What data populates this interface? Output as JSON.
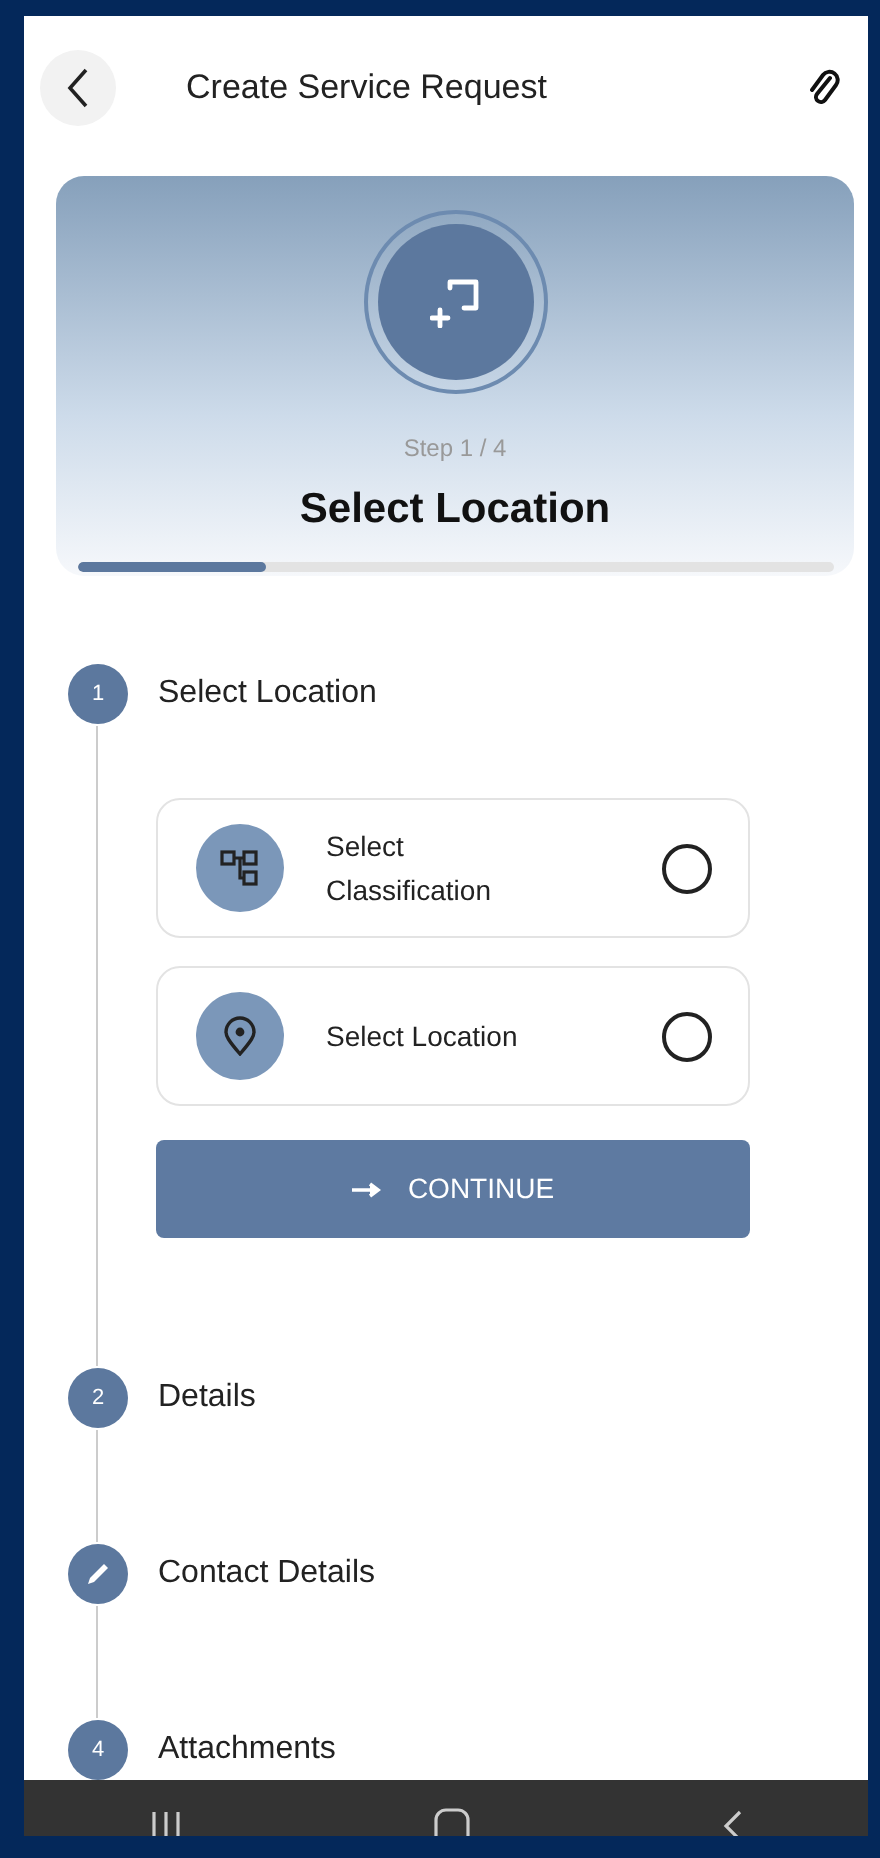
{
  "header": {
    "title": "Create Service Request"
  },
  "hero": {
    "step_text": "Step 1 / 4",
    "title": "Select Location",
    "progress": {
      "level": 0.25
    }
  },
  "steps": [
    {
      "kind": "number",
      "number": "1",
      "label": "Select Location",
      "options": [
        {
          "kind": "tree",
          "label": "Select Classification",
          "selected": false
        },
        {
          "kind": "pin",
          "label": "Select Location",
          "selected": false
        }
      ],
      "button": "CONTINUE"
    },
    {
      "kind": "number",
      "number": "2",
      "label": "Details"
    },
    {
      "kind": "edit",
      "label": "Contact Details"
    },
    {
      "kind": "number",
      "number": "4",
      "label": "Attachments"
    }
  ]
}
